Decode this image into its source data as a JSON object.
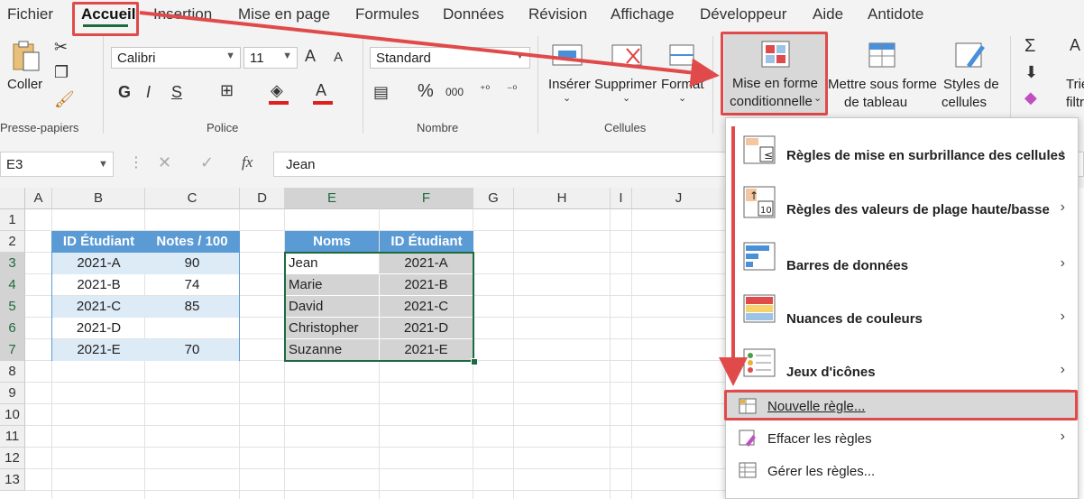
{
  "menubar": {
    "tabs": [
      "Fichier",
      "Accueil",
      "Insertion",
      "Mise en page",
      "Formules",
      "Données",
      "Révision",
      "Affichage",
      "Développeur",
      "Aide",
      "Antidote"
    ]
  },
  "ribbon": {
    "clipboard": {
      "paste_label": "Coller",
      "group_label": "Presse-papiers"
    },
    "font": {
      "font_name": "Calibri",
      "font_size": "11",
      "bold": "G",
      "italic": "I",
      "underline": "S",
      "grow": "A",
      "shrink": "A",
      "font_color": "A",
      "group_label": "Police"
    },
    "number": {
      "format": "Standard",
      "percent": "%",
      "thousands": "000",
      "group_label": "Nombre"
    },
    "cells": {
      "insert": "Insérer",
      "delete": "Supprimer",
      "format": "Format",
      "group_label": "Cellules"
    },
    "styles": {
      "conditional_line1": "Mise en forme",
      "conditional_line2": "conditionnelle",
      "table_line1": "Mettre sous forme",
      "table_line2": "de tableau",
      "cellstyles_line1": "Styles de",
      "cellstyles_line2": "cellules"
    },
    "editing": {
      "sort_label": "Trie",
      "filter_label": "filtr"
    }
  },
  "formulabar": {
    "namebox": "E3",
    "fx": "fx",
    "value": "Jean"
  },
  "grid": {
    "columns": [
      "A",
      "B",
      "C",
      "D",
      "E",
      "F",
      "G",
      "H",
      "I",
      "J"
    ],
    "rows": [
      "1",
      "2",
      "3",
      "4",
      "5",
      "6",
      "7",
      "8",
      "9",
      "10",
      "11",
      "12",
      "13"
    ]
  },
  "table1": {
    "headers": [
      "ID Étudiant",
      "Notes / 100"
    ],
    "rows": [
      [
        "2021-A",
        "90"
      ],
      [
        "2021-B",
        "74"
      ],
      [
        "2021-C",
        "85"
      ],
      [
        "2021-D",
        ""
      ],
      [
        "2021-E",
        "70"
      ]
    ]
  },
  "table2": {
    "headers": [
      "Noms",
      "ID Étudiant"
    ],
    "rows": [
      [
        "Jean",
        "2021-A"
      ],
      [
        "Marie",
        "2021-B"
      ],
      [
        "David",
        "2021-C"
      ],
      [
        "Christopher",
        "2021-D"
      ],
      [
        "Suzanne",
        "2021-E"
      ]
    ]
  },
  "dropdown": {
    "items": [
      "Règles de mise en surbrillance des cellules",
      "Règles des valeurs de plage haute/basse",
      "Barres de données",
      "Nuances de couleurs",
      "Jeux d'icônes"
    ],
    "new_rule": "Nouvelle règle...",
    "clear_rules": "Effacer les règles",
    "manage_rules": "Gérer les règles..."
  },
  "colors": {
    "accent_green": "#1e6a3f",
    "highlight_red": "#e04a4a",
    "table_header": "#5b9bd5",
    "table_band": "#ddebf7"
  }
}
